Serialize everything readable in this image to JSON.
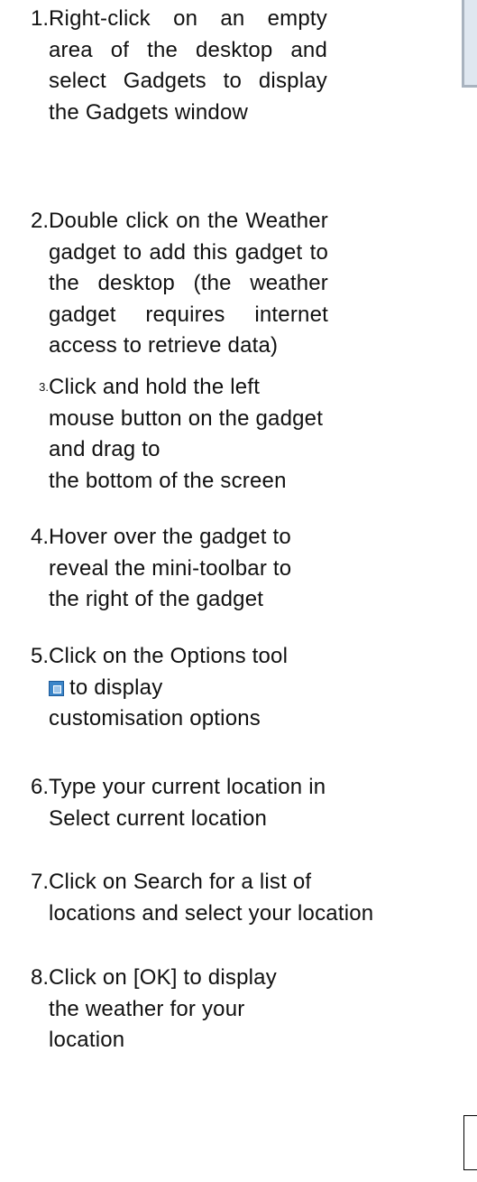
{
  "steps": [
    {
      "number": "1.",
      "lines": [
        "Right-click on an empty",
        "area of the desktop and",
        "select Gadgets to display",
        "the Gadgets window"
      ]
    },
    {
      "number": "2.",
      "lines": [
        "Double click on the Weather",
        "gadget to add this gadget to",
        "the desktop (the weather",
        "gadget requires internet",
        "access to retrieve data)"
      ]
    },
    {
      "number": "3.",
      "lines": [
        "Click and hold the left",
        "mouse button on the gadget",
        "and drag to",
        "the bottom of the screen"
      ]
    },
    {
      "number": "4.",
      "lines": [
        "Hover over the gadget to",
        "reveal the mini-toolbar to",
        "the right of the gadget"
      ]
    },
    {
      "number": "5.",
      "lines": [
        "Click on the Options tool",
        "to display",
        "customisation options"
      ],
      "icon": "options-tool-icon"
    },
    {
      "number": "6.",
      "lines": [
        "Type your current location in",
        "Select current location"
      ]
    },
    {
      "number": "7.",
      "lines": [
        "Click on Search for a list of",
        "locations and select your location"
      ]
    },
    {
      "number": "8.",
      "lines": [
        "Click on [OK] to display",
        "the weather for your",
        "location"
      ]
    }
  ]
}
